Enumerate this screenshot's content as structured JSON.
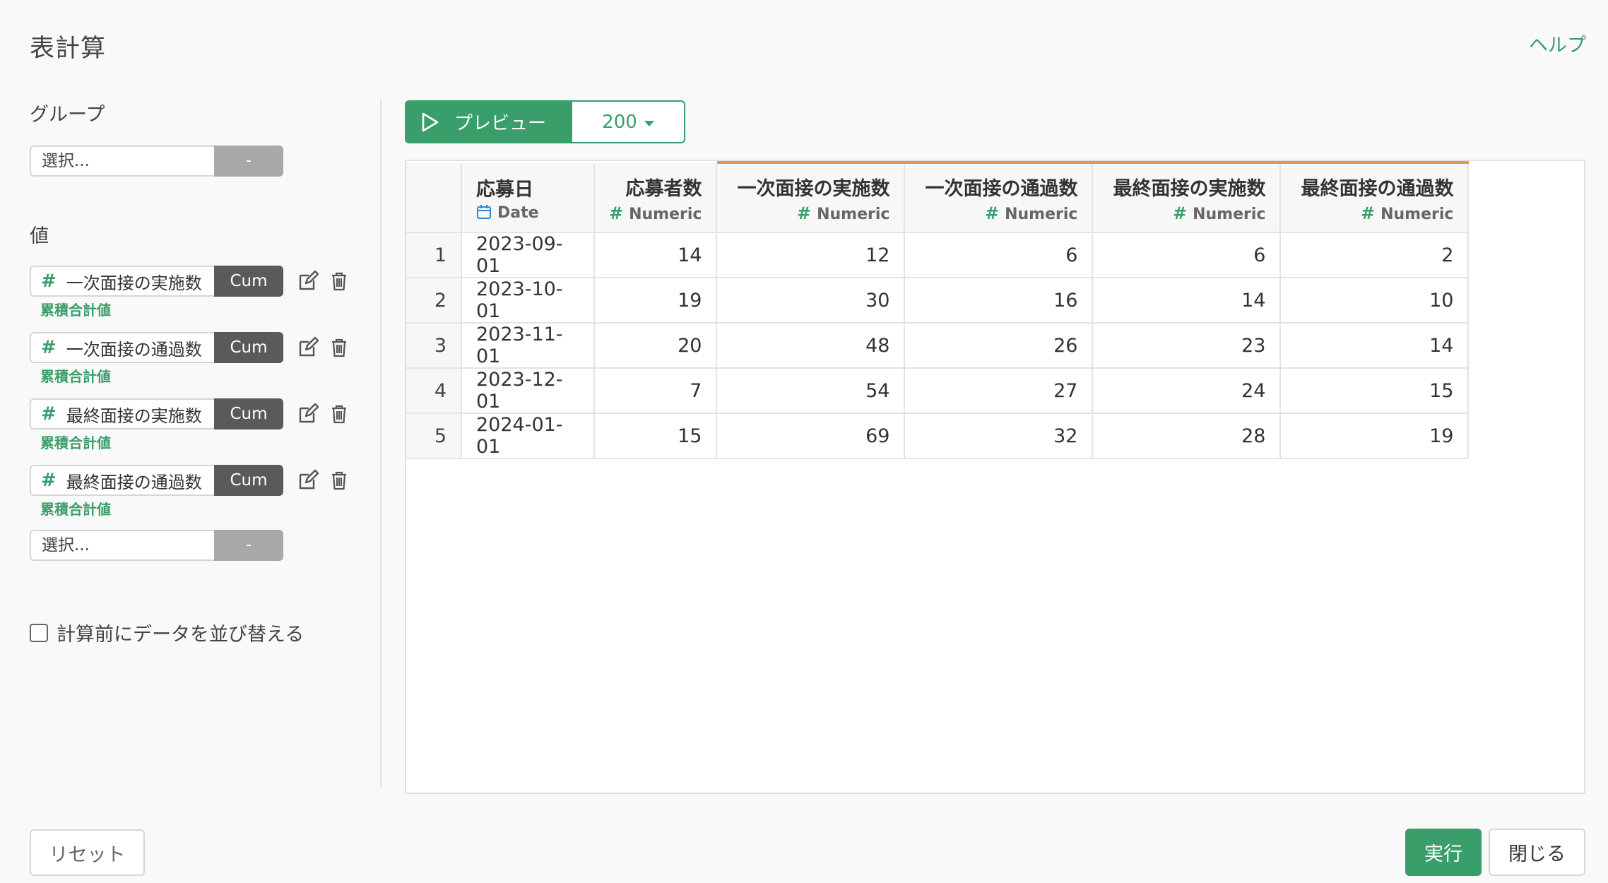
{
  "dialog": {
    "title": "表計算",
    "help_label": "ヘルプ"
  },
  "group": {
    "label": "グループ",
    "select_placeholder": "選択...",
    "button_label": "-"
  },
  "values": {
    "label": "値",
    "items": [
      {
        "field": "一次面接の実施数",
        "aggregation": "Cum",
        "calc_label": "累積合計値"
      },
      {
        "field": "一次面接の通過数",
        "aggregation": "Cum",
        "calc_label": "累積合計値"
      },
      {
        "field": "最終面接の実施数",
        "aggregation": "Cum",
        "calc_label": "累積合計値"
      },
      {
        "field": "最終面接の通過数",
        "aggregation": "Cum",
        "calc_label": "累積合計値"
      }
    ],
    "select_placeholder": "選択...",
    "button_label": "-"
  },
  "sort_option": {
    "label": "計算前にデータを並び替える",
    "checked": false
  },
  "toolbar": {
    "preview_label": "プレビュー",
    "row_count": "200"
  },
  "table": {
    "columns": [
      {
        "name": "応募日",
        "type": "Date"
      },
      {
        "name": "応募者数",
        "type": "Numeric"
      },
      {
        "name": "一次面接の実施数",
        "type": "Numeric"
      },
      {
        "name": "一次面接の通過数",
        "type": "Numeric"
      },
      {
        "name": "最終面接の実施数",
        "type": "Numeric"
      },
      {
        "name": "最終面接の通過数",
        "type": "Numeric"
      }
    ],
    "rows": [
      [
        "1",
        "2023-09-01",
        "14",
        "12",
        "6",
        "6",
        "2"
      ],
      [
        "2",
        "2023-10-01",
        "19",
        "30",
        "16",
        "14",
        "10"
      ],
      [
        "3",
        "2023-11-01",
        "20",
        "48",
        "26",
        "23",
        "14"
      ],
      [
        "4",
        "2023-12-01",
        "7",
        "54",
        "27",
        "24",
        "15"
      ],
      [
        "5",
        "2024-01-01",
        "15",
        "69",
        "32",
        "28",
        "19"
      ]
    ],
    "accent_color": "#e8954e"
  },
  "footer": {
    "reset_label": "リセット",
    "run_label": "実行",
    "close_label": "閉じる"
  },
  "colors": {
    "primary": "#3a9e6a",
    "dark_pill": "#5a5a5a"
  }
}
